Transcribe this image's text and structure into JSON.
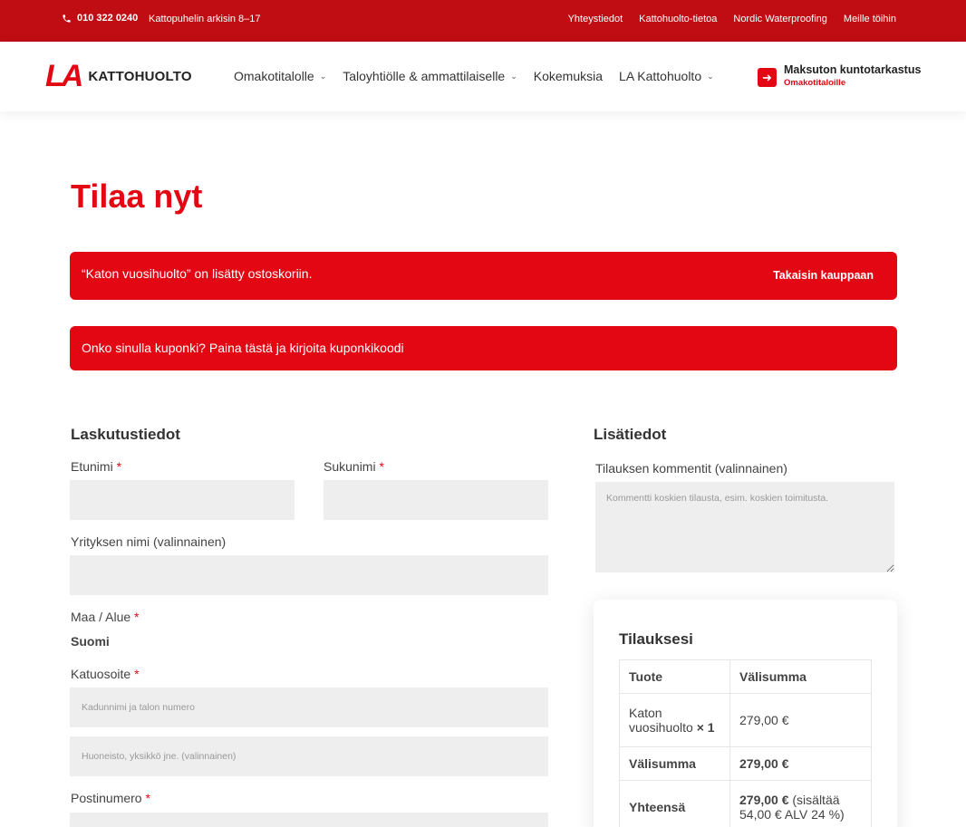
{
  "topbar": {
    "phone": "010 322 0240",
    "hours": "Kattopuhelin arkisin 8–17",
    "links": [
      "Yhteystiedot",
      "Kattohuolto-tietoa",
      "Nordic Waterproofing",
      "Meille töihin"
    ]
  },
  "header": {
    "logo_mark": "LA",
    "logo_text": "KATTOHUOLTO",
    "nav": [
      {
        "label": "Omakotitalolle",
        "has_dropdown": true
      },
      {
        "label": "Taloyhtiölle & ammattilaiselle",
        "has_dropdown": true
      },
      {
        "label": "Kokemuksia",
        "has_dropdown": false
      },
      {
        "label": "LA Kattohuolto",
        "has_dropdown": true
      }
    ],
    "cta_title": "Maksuton kuntotarkastus",
    "cta_sub": "Omakotitaloille"
  },
  "page": {
    "title": "Tilaa nyt"
  },
  "notices": {
    "added": "“Katon vuosihuolto” on lisätty ostoskoriin.",
    "back": "Takaisin kauppaan",
    "coupon": "Onko sinulla kuponki? Paina tästä ja kirjoita kuponkikoodi"
  },
  "billing": {
    "heading": "Laskutustiedot",
    "first_name_label": "Etunimi",
    "last_name_label": "Sukunimi",
    "company_label": "Yrityksen nimi (valinnainen)",
    "country_label": "Maa / Alue",
    "country_value": "Suomi",
    "street_label": "Katuosoite",
    "street_placeholder": "Kadunnimi ja talon numero",
    "street2_placeholder": "Huoneisto, yksikkö jne. (valinnainen)",
    "postcode_label": "Postinumero",
    "required_mark": "*"
  },
  "additional": {
    "heading": "Lisätiedot",
    "comment_label": "Tilauksen kommentit (valinnainen)",
    "comment_placeholder": "Kommentti koskien tilausta, esim. koskien toimitusta."
  },
  "order": {
    "heading": "Tilauksesi",
    "col_product": "Tuote",
    "col_subtotal": "Välisumma",
    "item_name_1": "Katon",
    "item_name_2": "vuosihuolto",
    "item_qty": "× 1",
    "item_price": "279,00 €",
    "subtotal_label": "Välisumma",
    "subtotal_value": "279,00 €",
    "total_label": "Yhteensä",
    "total_value": "279,00 €",
    "total_tax_1": "(sisältää",
    "total_tax_2": "54,00 € ALV 24 %)"
  },
  "colors": {
    "brand_red": "#e30613",
    "topbar_red": "#c00d14",
    "field_bg": "#eeeeee"
  }
}
